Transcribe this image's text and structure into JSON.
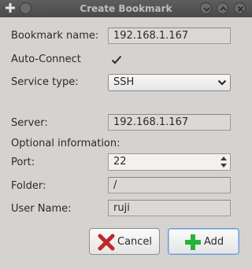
{
  "window": {
    "title": "Create Bookmark"
  },
  "form": {
    "bookmark_name": {
      "label": "Bookmark name:",
      "value": "192.168.1.167"
    },
    "auto_connect": {
      "label": "Auto-Connect",
      "checked": true
    },
    "service_type": {
      "label": "Service type:",
      "value": "SSH"
    },
    "server": {
      "label": "Server:",
      "value": "192.168.1.167"
    },
    "optional_header": "Optional information:",
    "port": {
      "label": "Port:",
      "value": "22"
    },
    "folder": {
      "label": "Folder:",
      "value": "/"
    },
    "user_name": {
      "label": "User Name:",
      "value": "ruji"
    }
  },
  "buttons": {
    "cancel": "Cancel",
    "add": "Add"
  },
  "colors": {
    "cancel_icon": "#c0262a",
    "add_icon": "#27b23c"
  }
}
